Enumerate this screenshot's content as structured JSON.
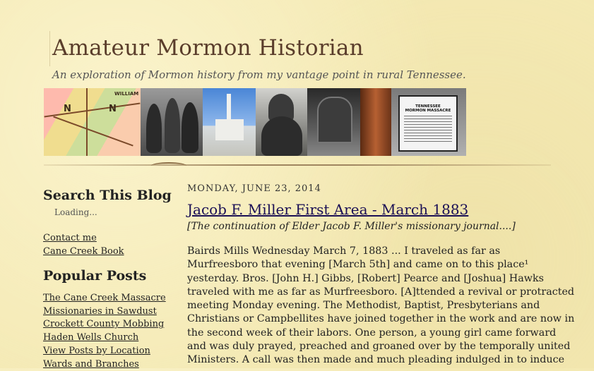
{
  "blog": {
    "title": "Amateur Mormon Historian",
    "tagline": "An exploration of Mormon history from my vantage point in rural Tennessee.",
    "banner_marker_title": "TENNESSEE\nMORMON MASSACRE"
  },
  "sidebar": {
    "search_heading": "Search This Blog",
    "search_status": "Loading...",
    "links": [
      "Contact me",
      "Cane Creek Book"
    ],
    "popular_heading": "Popular Posts",
    "popular_posts": [
      "The Cane Creek Massacre",
      "Missionaries in Sawdust",
      "Crockett County Mobbing",
      "Haden Wells Church",
      "View Posts by Location",
      "Wards and Branches"
    ]
  },
  "post": {
    "date": "MONDAY, JUNE 23, 2014",
    "title": "Jacob F. Miller First Area - March 1883",
    "subtitle": "[The continuation of Elder Jacob F. Miller's missionary journal....]",
    "body_lines": [
      "Bairds Mills Wednesday March 7, 1883  ... I traveled as far as",
      "Murfreesboro that evening [March 5th] and came on to this place¹",
      "yesterday. Bros. [John H.] Gibbs, [Robert] Pearce and [Joshua] Hawks",
      "traveled with me as far as Murfreesboro. [A]ttended a revival or protracted",
      "meeting Monday evening. The Methodist, Baptist, Presbyterians and",
      "Christians or Campbellites have joined together in the work and are now in",
      "the second week of their labors. One person, a young girl came forward",
      "and was duly prayed, preached and groaned over by the temporally united",
      "Ministers. A call was then made and much pleading indulged in to induce"
    ]
  },
  "colors": {
    "background": "#f4e9b3",
    "title": "#5a3d2b",
    "post_title": "#1a0f55"
  }
}
